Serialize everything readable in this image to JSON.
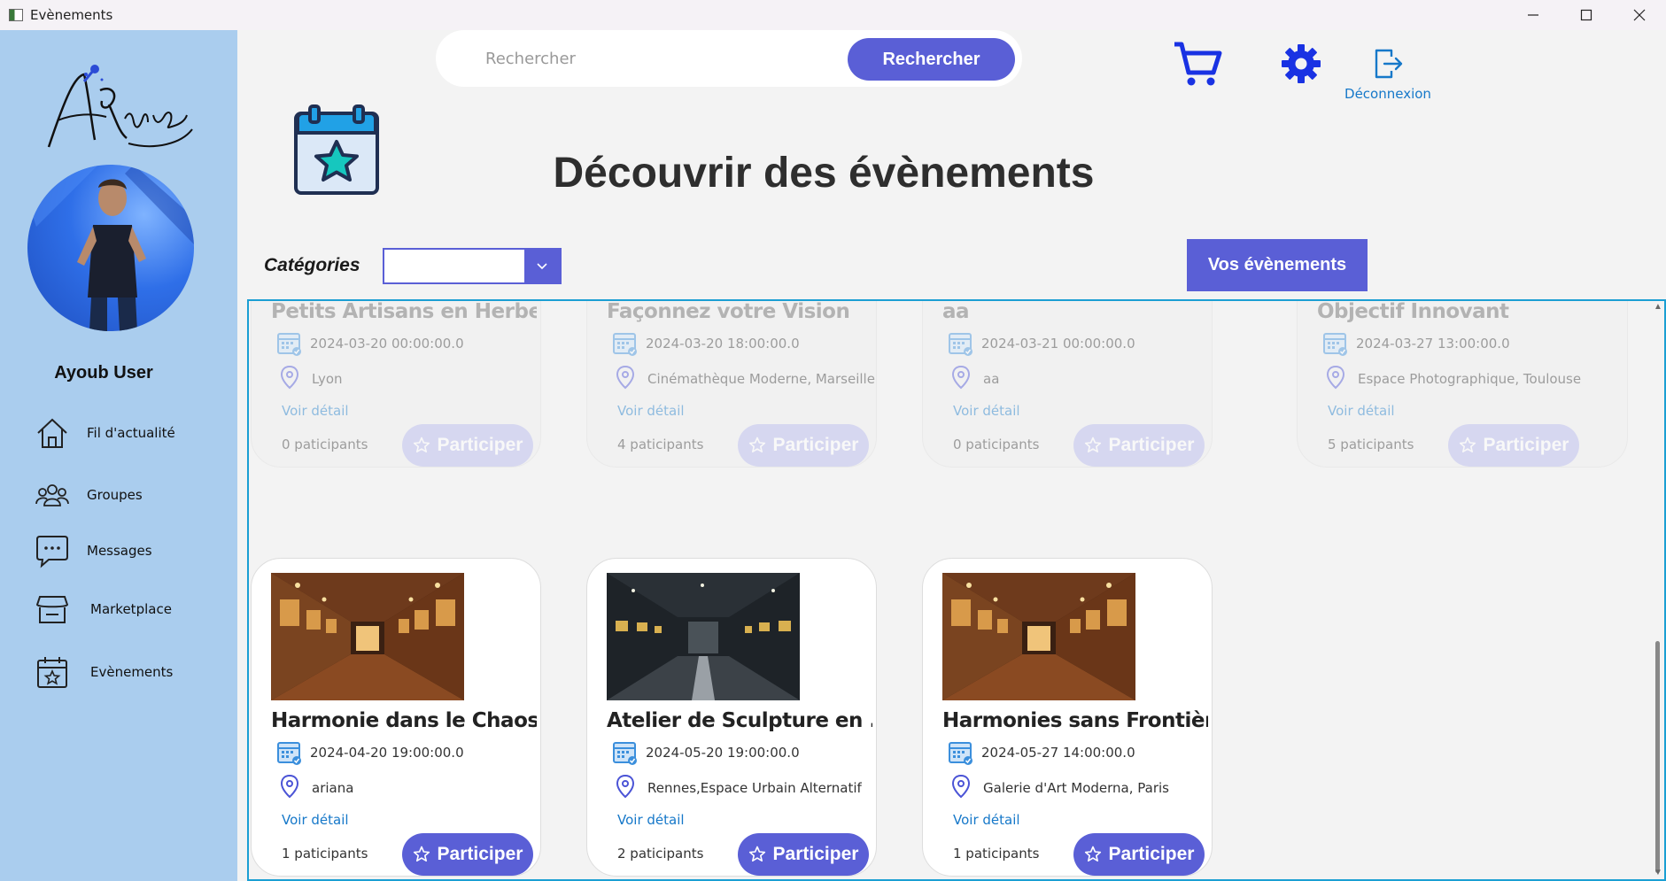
{
  "window": {
    "title": "Evènements"
  },
  "sidebar": {
    "user_name": "Ayoub User",
    "items": [
      {
        "label": "Fil d'actualité",
        "icon": "home-icon"
      },
      {
        "label": "Groupes",
        "icon": "people-icon"
      },
      {
        "label": "Messages",
        "icon": "chat-icon"
      },
      {
        "label": "Marketplace",
        "icon": "store-icon"
      },
      {
        "label": "Evènements",
        "icon": "calendar-star-icon"
      }
    ]
  },
  "header": {
    "search_placeholder": "Rechercher",
    "search_button": "Rechercher",
    "logout_label": "Déconnexion"
  },
  "page": {
    "title": "Découvrir des évènements",
    "categories_label": "Catégories",
    "category_value": "",
    "my_events_button": "Vos évènements"
  },
  "colors": {
    "accent": "#5a5fd6",
    "sidebar": "#aacdee",
    "link": "#1678c9",
    "border": "#1b9fd3"
  },
  "events": [
    {
      "title": "Petits Artisans en Herbee",
      "date": "2024-03-20 00:00:00.0",
      "location": "Lyon",
      "detail": "Voir détail",
      "participants": "0 paticipants",
      "button": "Participer"
    },
    {
      "title": "Façonnez votre Vision",
      "date": "2024-03-20 18:00:00.0",
      "location": "Cinémathèque Moderne, Marseille",
      "detail": "Voir détail",
      "participants": "4 paticipants",
      "button": "Participer"
    },
    {
      "title": "aa",
      "date": "2024-03-21 00:00:00.0",
      "location": "aa",
      "detail": "Voir détail",
      "participants": "0 paticipants",
      "button": "Participer"
    },
    {
      "title": "Objectif Innovant",
      "date": "2024-03-27 13:00:00.0",
      "location": "Espace Photographique, Toulouse",
      "detail": "Voir détail",
      "participants": "5 paticipants",
      "button": "Participer"
    },
    {
      "title": "Harmonie dans le Chaos",
      "date": "2024-04-20 19:00:00.0",
      "location": "ariana",
      "detail": "Voir détail",
      "participants": "1 paticipants",
      "button": "Participer"
    },
    {
      "title": "Atelier de Sculpture en ...",
      "date": "2024-05-20 19:00:00.0",
      "location": "Rennes,Espace Urbain Alternatif",
      "detail": "Voir détail",
      "participants": "2 paticipants",
      "button": "Participer"
    },
    {
      "title": "Harmonies sans Frontières",
      "date": "2024-05-27 14:00:00.0",
      "location": "Galerie d'Art Moderna, Paris",
      "detail": "Voir détail",
      "participants": "1 paticipants",
      "button": "Participer"
    }
  ]
}
